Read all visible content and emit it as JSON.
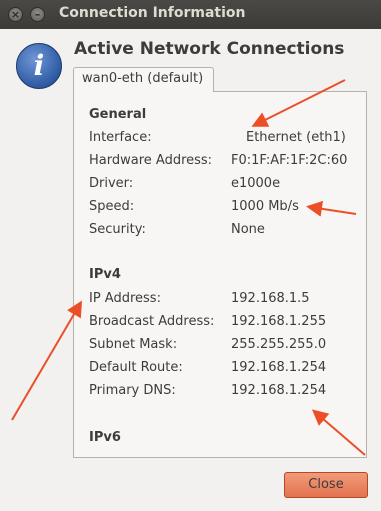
{
  "window": {
    "title": "Connection Information"
  },
  "header": {
    "title": "Active Network Connections"
  },
  "tabs": [
    {
      "label": "wan0-eth (default)"
    }
  ],
  "general": {
    "heading": "General",
    "rows": [
      {
        "label": "Interface:",
        "value": "Ethernet (eth1)"
      },
      {
        "label": "Hardware Address:",
        "value": "F0:1F:AF:1F:2C:60"
      },
      {
        "label": "Driver:",
        "value": "e1000e"
      },
      {
        "label": "Speed:",
        "value": "1000 Mb/s"
      },
      {
        "label": "Security:",
        "value": "None"
      }
    ]
  },
  "ipv4": {
    "heading": "IPv4",
    "rows": [
      {
        "label": "IP Address:",
        "value": "192.168.1.5"
      },
      {
        "label": "Broadcast Address:",
        "value": "192.168.1.255"
      },
      {
        "label": "Subnet Mask:",
        "value": "255.255.255.0"
      },
      {
        "label": "Default Route:",
        "value": "192.168.1.254"
      },
      {
        "label": "Primary DNS:",
        "value": "192.168.1.254"
      }
    ]
  },
  "ipv6": {
    "heading": "IPv6"
  },
  "buttons": {
    "close_label": "Close"
  },
  "icons": {
    "info": "info-icon",
    "window_close": "close-icon",
    "window_minimize": "minimize-icon"
  },
  "colors": {
    "annotation_arrow": "#ec4f27",
    "close_button": "#e9805c",
    "titlebar": "#3c3b37"
  }
}
